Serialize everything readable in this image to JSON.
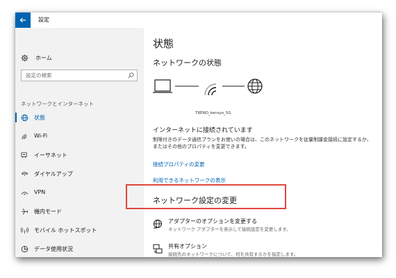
{
  "window": {
    "title": "設定"
  },
  "sidebar": {
    "home_label": "ホーム",
    "search_placeholder": "設定の検索",
    "section_label": "ネットワークとインターネット",
    "items": [
      {
        "label": "状態",
        "icon": "globe-icon",
        "active": true
      },
      {
        "label": "Wi-Fi",
        "icon": "wifi-icon"
      },
      {
        "label": "イーサネット",
        "icon": "ethernet-icon"
      },
      {
        "label": "ダイヤルアップ",
        "icon": "dialup-icon"
      },
      {
        "label": "VPN",
        "icon": "vpn-icon"
      },
      {
        "label": "機内モード",
        "icon": "airplane-icon"
      },
      {
        "label": "モバイル ホットスポット",
        "icon": "hotspot-icon"
      },
      {
        "label": "データ使用状況",
        "icon": "data-usage-icon"
      }
    ]
  },
  "main": {
    "title": "状態",
    "network_status_heading": "ネットワークの状態",
    "network_name": "TREND_kensyo_5G",
    "connected_text": "インターネットに接続されています",
    "description": "制限付きのデータ通信プランをお使いの場合は、このネットワークを従量制課金接続に設定するか、またはその他のプロパティを変更できます。",
    "link_properties": "接続プロパティの変更",
    "link_networks": "利用できるネットワークの表示",
    "change_settings_heading": "ネットワーク設定の変更",
    "options": [
      {
        "title": "アダプターのオプションを変更する",
        "desc": "ネットワーク アダプターを表示して接続設定を変更します。",
        "icon": "adapter-globe-icon"
      },
      {
        "title": "共有オプション",
        "desc": "接続先のネットワークについて、何を共有するかを指定します。",
        "icon": "sharing-icon"
      }
    ]
  },
  "colors": {
    "accent": "#0063b1",
    "highlight": "#e0463a",
    "sidebar_bg": "#f2f2f2"
  }
}
